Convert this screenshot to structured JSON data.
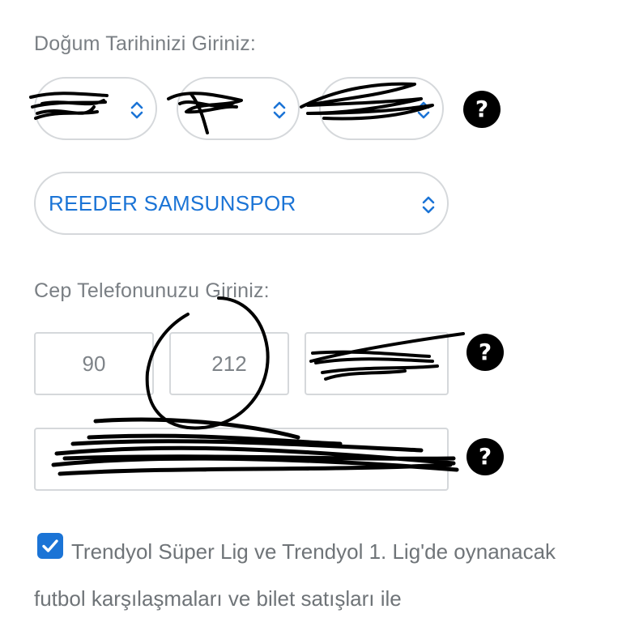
{
  "birth_date": {
    "label": "Doğum Tarihinizi Giriniz:",
    "help_icon": "?"
  },
  "team": {
    "selected": "REEDER SAMSUNSPOR"
  },
  "phone": {
    "label": "Cep Telefonunuzu Giriniz:",
    "country_code": "90",
    "area_code": "212",
    "help_icon": "?"
  },
  "email": {
    "help_icon": "?"
  },
  "consent": {
    "checked": true,
    "text": "Trendyol Süper Lig ve Trendyol 1. Lig'de oynanacak futbol karşılaşmaları ve bilet satışları ile"
  },
  "colors": {
    "accent": "#1b74d6",
    "border": "#d5d8db",
    "label": "#7a7f84"
  },
  "icons": {
    "chevron": "chevron-up-down-icon",
    "help": "help-circle-icon",
    "check": "checkmark-icon"
  }
}
